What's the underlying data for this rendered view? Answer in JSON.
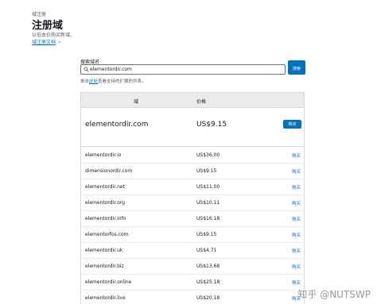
{
  "header": {
    "breadcrumb": "域注册",
    "title": "注册域",
    "description": "以低本价购买新域。",
    "doc_link": "域注册文档"
  },
  "search": {
    "label": "搜索域名",
    "value": "elementordir.com",
    "button_label": "搜索",
    "hint_prefix": "单击",
    "hint_link": "此处",
    "hint_suffix": "查看支持的扩展的列表。"
  },
  "table": {
    "columns": [
      "域",
      "价格"
    ],
    "featured": {
      "domain": "elementordir.com",
      "price": "US$9.15",
      "buy_label": "购买"
    },
    "rows": [
      {
        "domain": "elementordir.io",
        "price": "US$36.00",
        "buy_label": "购买"
      },
      {
        "domain": "dimensionordir.com",
        "price": "US$9.15",
        "buy_label": "购买"
      },
      {
        "domain": "elementordir.net",
        "price": "US$11.00",
        "buy_label": "购买"
      },
      {
        "domain": "elementordir.org",
        "price": "US$10.11",
        "buy_label": "购买"
      },
      {
        "domain": "elementordir.info",
        "price": "US$16.18",
        "buy_label": "购买"
      },
      {
        "domain": "elementorfos.com",
        "price": "US$9.15",
        "buy_label": "购买"
      },
      {
        "domain": "elementordir.uk",
        "price": "US$4.71",
        "buy_label": "购买"
      },
      {
        "domain": "elementordir.biz",
        "price": "US$13.68",
        "buy_label": "购买"
      },
      {
        "domain": "elementordir.online",
        "price": "US$25.18",
        "buy_label": "购买"
      },
      {
        "domain": "elementordir.live",
        "price": "US$20.18",
        "buy_label": "购买"
      }
    ]
  },
  "watermark": "知乎 @NUTSWP",
  "colors": {
    "accent": "#0073bb",
    "header_bg": "#e9ebed",
    "border": "#d5dbdb"
  }
}
